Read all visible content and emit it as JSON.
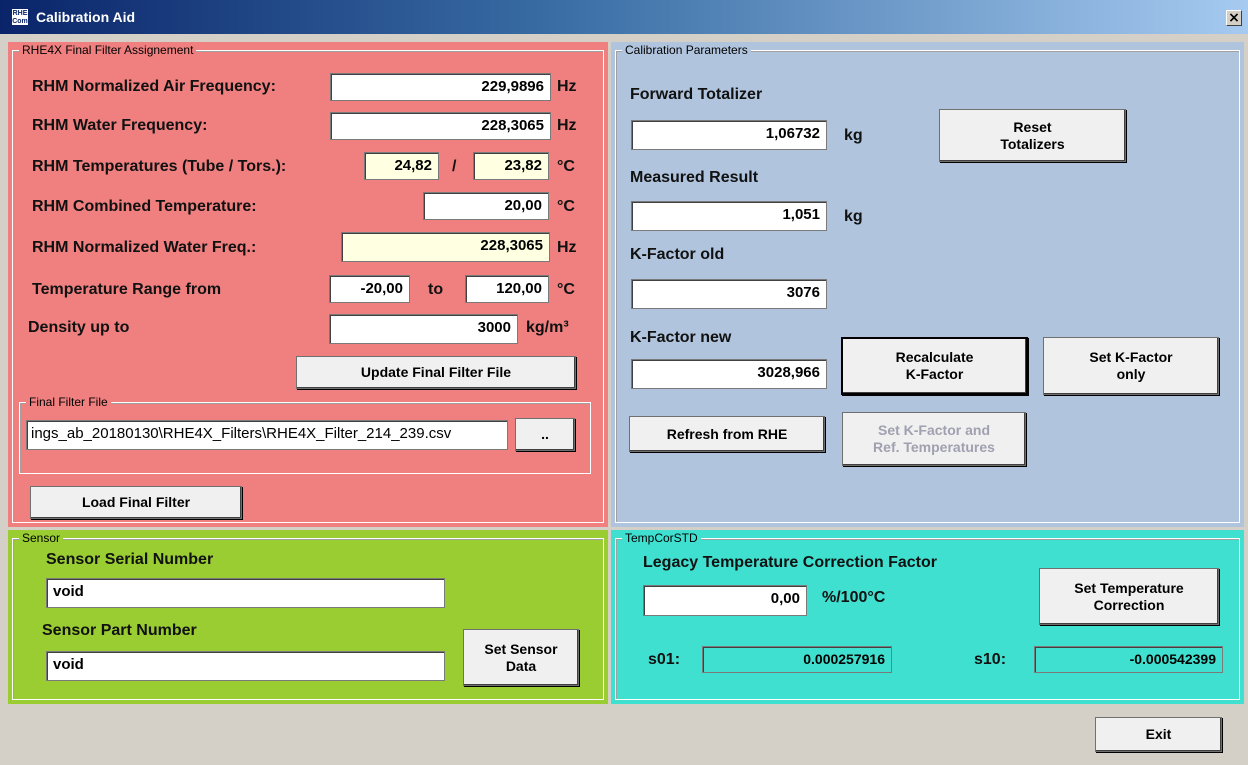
{
  "window": {
    "title": "Calibration Aid",
    "icon_text": "RHE Com",
    "close_glyph": "×"
  },
  "filter_panel": {
    "legend": "RHE4X Final Filter Assignement",
    "color": "#f08080",
    "rows": {
      "air_freq": {
        "label": "RHM Normalized Air Frequency:",
        "value": "229,9896",
        "unit": "Hz"
      },
      "water_freq": {
        "label": "RHM Water Frequency:",
        "value": "228,3065",
        "unit": "Hz"
      },
      "temps": {
        "label": "RHM Temperatures (Tube / Tors.):",
        "tube": "24,82",
        "sep": "/",
        "tors": "23,82",
        "unit": "°C"
      },
      "combined_temp": {
        "label": "RHM Combined Temperature:",
        "value": "20,00",
        "unit": "°C"
      },
      "norm_water": {
        "label": "RHM Normalized Water Freq.:",
        "value": "228,3065",
        "unit": "Hz"
      },
      "temp_range": {
        "label": "Temperature Range from",
        "from": "-20,00",
        "to_label": "to",
        "to": "120,00",
        "unit": "°C"
      },
      "density": {
        "label": "Density up to",
        "value": "3000",
        "unit": "kg/m³"
      }
    },
    "update_button": "Update Final Filter File",
    "file_group": {
      "legend": "Final Filter File",
      "path": "ings_ab_20180130\\RHE4X_Filters\\RHE4X_Filter_214_239.csv",
      "browse_label": ".."
    },
    "load_button": "Load Final Filter"
  },
  "calibration_panel": {
    "legend": "Calibration Parameters",
    "color": "#b0c4de",
    "forward_totalizer": {
      "label": "Forward Totalizer",
      "value": "1,06732",
      "unit": "kg"
    },
    "reset_button": "Reset\nTotalizers",
    "measured_result": {
      "label": "Measured Result",
      "value": "1,051",
      "unit": "kg"
    },
    "kfactor_old": {
      "label": "K-Factor old",
      "value": "3076"
    },
    "kfactor_new": {
      "label": "K-Factor new",
      "value": "3028,966"
    },
    "recalc_button": "Recalculate\nK-Factor",
    "set_kfactor_button": "Set K-Factor\nonly",
    "refresh_button": "Refresh from RHE",
    "set_kfactor_ref_button": "Set K-Factor and\nRef. Temperatures"
  },
  "sensor_panel": {
    "legend": "Sensor",
    "color": "#9acd32",
    "serial_label": "Sensor Serial Number",
    "serial_value": "void",
    "part_label": "Sensor Part Number",
    "part_value": "void",
    "set_button": "Set Sensor\nData"
  },
  "tempcor_panel": {
    "legend": "TempCorSTD",
    "color": "#40e0d0",
    "legacy_label": "Legacy Temperature Correction Factor",
    "legacy_value": "0,00",
    "legacy_unit": "%/100°C",
    "set_button": "Set Temperature\nCorrection",
    "s01_label": "s01:",
    "s01_value": "0.000257916",
    "s10_label": "s10:",
    "s10_value": "-0.000542399"
  },
  "exit_button": "Exit"
}
